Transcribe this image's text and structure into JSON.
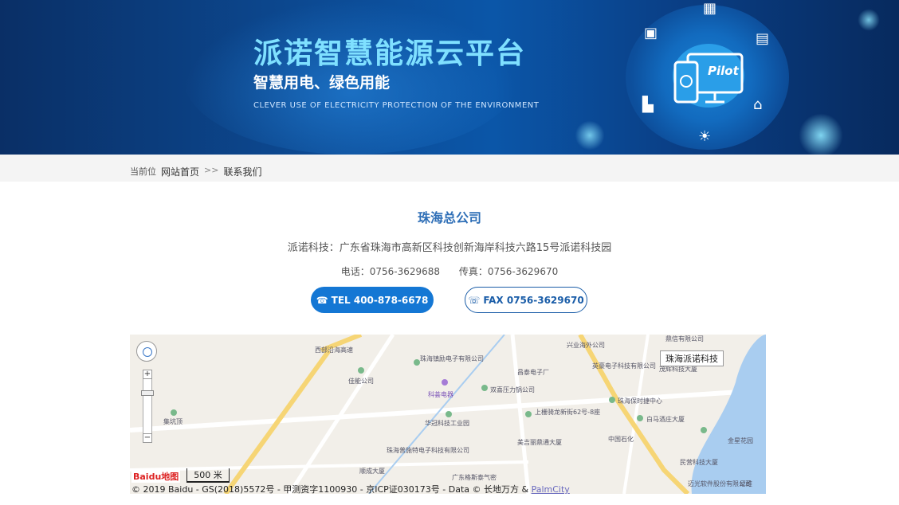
{
  "banner": {
    "title": "派诺智慧能源云平台",
    "subtitle": "智慧用电、绿色用能",
    "english": "CLEVER USE OF ELECTRICITY PROTECTION OF THE ENVIRONMENT",
    "logo_text": "Pilot",
    "colors": {
      "accent": "#7fe0ff",
      "background": "#0b56a8"
    }
  },
  "breadcrumb": {
    "lead": "当前位",
    "home": "网站首页",
    "separator": ">>",
    "current": "联系我们"
  },
  "contact": {
    "company": "珠海总公司",
    "address": "派诺科技：广东省珠海市高新区科技创新海岸科技六路15号派诺科技园",
    "phone": "电话：0756-3629688",
    "fax": "传真：0756-3629670",
    "tel_button": "TEL 400-878-6678",
    "fax_button": "FAX 0756-3629670"
  },
  "map": {
    "marker_label": "珠海派诺科技",
    "scale": "500 米",
    "logo": "Baidu地图",
    "copyright": "© 2019 Baidu - GS(2018)5572号 - 甲测资字1100930 - 京ICP证030173号 - Data © 长地万方 & ",
    "palmcity": "PalmCity",
    "places": [
      "西部沿海高速",
      "珠海镇励电子有限公司",
      "兴业海外公司",
      "英豪电子科技有限公司",
      "茂辉科技大厦",
      "佳能公司",
      "科荟电器",
      "双喜压力锅公司",
      "昌泰电子厂",
      "上栅骑龙新街62号-8座",
      "华冠科技工业园",
      "珠海保时捷中心",
      "白马酒庄大厦",
      "中国石化",
      "美吉丽鼎通大厦",
      "金星花园",
      "珠海普施特电子科技有限公司",
      "顺成大厦",
      "广东格斯泰气密",
      "民营科技大厦",
      "迈光软件股份有限公司",
      "尼维",
      "集坑顶",
      "鼎信有限公司"
    ]
  }
}
